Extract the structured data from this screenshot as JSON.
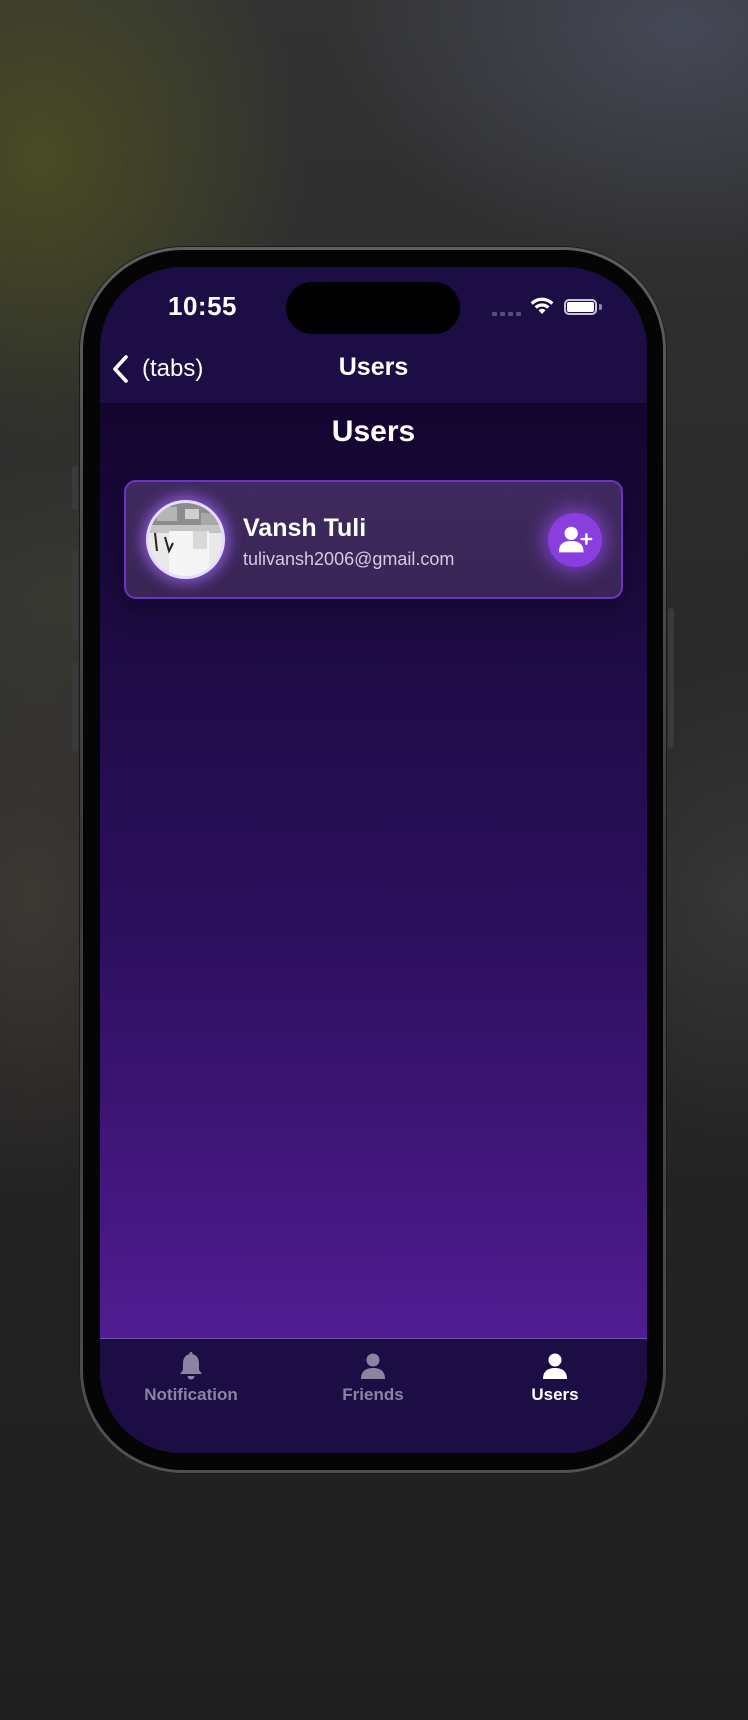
{
  "status_bar": {
    "time": "10:55"
  },
  "nav": {
    "back_label": "(tabs)",
    "title": "Users"
  },
  "page": {
    "title": "Users"
  },
  "users": [
    {
      "name": "Vansh Tuli",
      "email": "tulivansh2006@gmail.com",
      "action_icon": "add-user-icon"
    }
  ],
  "tabs": [
    {
      "label": "Notification",
      "icon": "bell-icon",
      "active": false
    },
    {
      "label": "Friends",
      "icon": "person-icon",
      "active": false
    },
    {
      "label": "Users",
      "icon": "person-icon",
      "active": true
    }
  ],
  "colors": {
    "accent": "#8a3ee0",
    "nav_background": "#1c0e45",
    "card_border": "#6b35c4",
    "inactive_tab": "#8b83a3",
    "active_tab": "#ffffff"
  }
}
